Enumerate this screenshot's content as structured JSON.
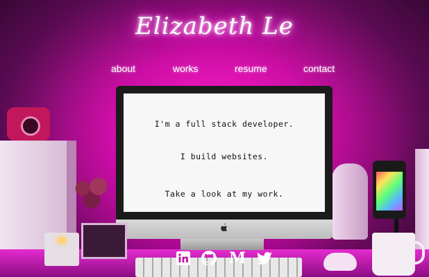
{
  "header": {
    "title": "Elizabeth Le"
  },
  "nav": {
    "items": [
      {
        "label": "about"
      },
      {
        "label": "works"
      },
      {
        "label": "resume"
      },
      {
        "label": "contact"
      }
    ]
  },
  "screen": {
    "lines": [
      "I'm a full stack developer.",
      "I build websites.",
      "Take a look at my work."
    ]
  },
  "social": {
    "icons": [
      "linkedin-icon",
      "github-icon",
      "medium-icon",
      "twitter-icon"
    ],
    "medium_letter": "M"
  },
  "colors": {
    "accent": "#ff2bd6",
    "neon_text": "#ffffff",
    "screen_bg": "#f7f7f7"
  }
}
